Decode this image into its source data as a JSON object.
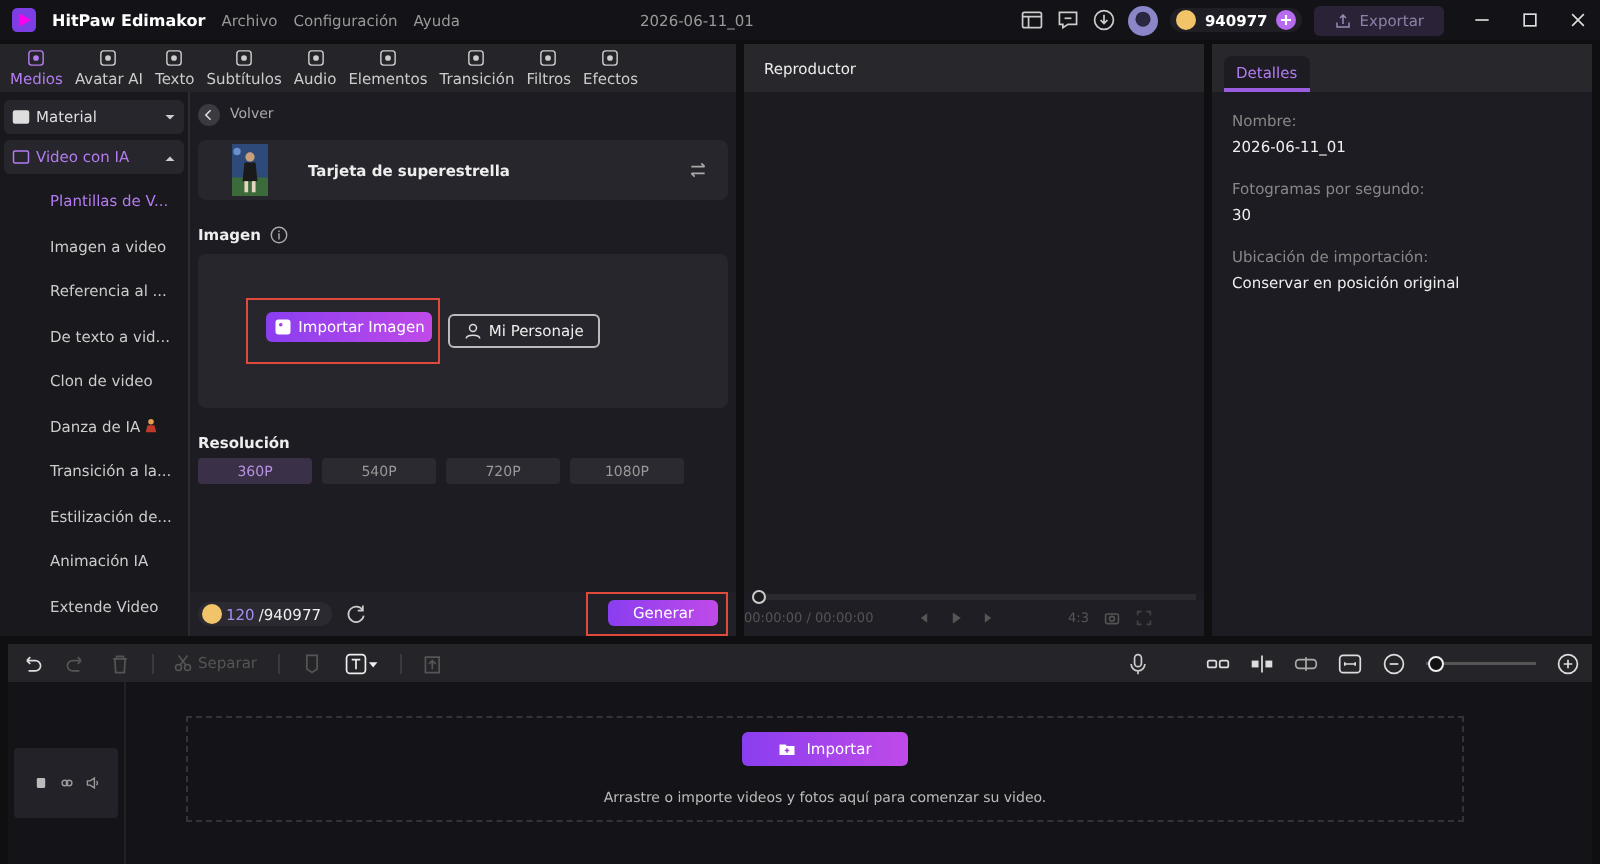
{
  "app": {
    "name": "HitPaw Edimakor",
    "menu": [
      "Archivo",
      "Configuración",
      "Ayuda"
    ],
    "project_title": "2026-06-11_01",
    "coins": "940977",
    "export_label": "Exportar"
  },
  "tool_tabs": [
    {
      "label": "Medios",
      "selected": true
    },
    {
      "label": "Avatar AI",
      "selected": false
    },
    {
      "label": "Texto",
      "selected": false
    },
    {
      "label": "Subtítulos",
      "selected": false
    },
    {
      "label": "Audio",
      "selected": false
    },
    {
      "label": "Elementos",
      "selected": false
    },
    {
      "label": "Transición",
      "selected": false
    },
    {
      "label": "Filtros",
      "selected": false
    },
    {
      "label": "Efectos",
      "selected": false
    }
  ],
  "sidebar": [
    {
      "label": "Material",
      "expanded": false
    },
    {
      "label": "Video con IA",
      "expanded": true,
      "children": [
        {
          "label": "Plantillas de V...",
          "selected": true
        },
        {
          "label": "Imagen a video",
          "selected": false
        },
        {
          "label": "Referencia al ...",
          "selected": false
        },
        {
          "label": "De texto a vid...",
          "selected": false
        },
        {
          "label": "Clon de video",
          "selected": false
        },
        {
          "label": "Danza de IA",
          "selected": false,
          "kind": "dance"
        },
        {
          "label": "Transición a la...",
          "selected": false
        },
        {
          "label": "Estilización de...",
          "selected": false
        },
        {
          "label": "Animación IA",
          "selected": false
        },
        {
          "label": "Extende Video",
          "selected": false
        }
      ]
    }
  ],
  "panel": {
    "back_label": "Volver",
    "template_title": "Tarjeta de superestrella",
    "image_label": "Imagen",
    "import_image_label": "Importar Imagen",
    "character_label": "Mi Personaje",
    "resolution_label": "Resolución",
    "resolutions": [
      {
        "label": "360P",
        "selected": true
      },
      {
        "label": "540P",
        "selected": false
      },
      {
        "label": "720P",
        "selected": false
      },
      {
        "label": "1080P",
        "selected": false
      }
    ],
    "credits_used": "120",
    "credits_total": "/940977",
    "generate_label": "Generar"
  },
  "player": {
    "title": "Reproductor",
    "level": 0,
    "time": "00:00:00 / 00:00:00",
    "aspect": "4:3"
  },
  "details": {
    "tab": {
      "label": "Detalles",
      "selected": true
    },
    "fields": [
      {
        "label": "Nombre:",
        "value": "2026-06-11_01"
      },
      {
        "label": "Fotogramas por segundo:",
        "value": "30"
      },
      {
        "label": "Ubicación de importación:",
        "value": "Conservar en posición original"
      }
    ]
  },
  "timeline": {
    "split_label": "Separar",
    "zoom": {
      "level": 0.03
    },
    "import_label": "Importar",
    "hint": "Arrastre o importe videos y fotos aquí para comenzar su video."
  }
}
